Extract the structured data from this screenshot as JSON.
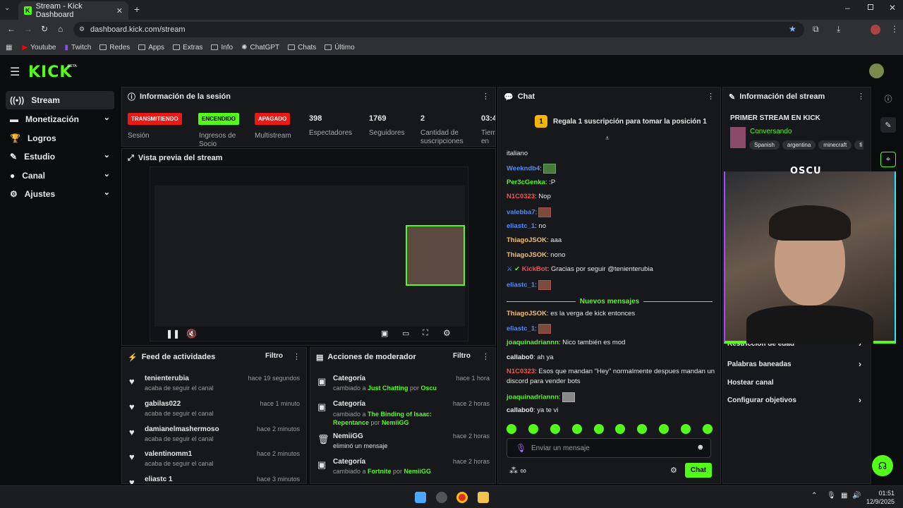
{
  "browser": {
    "tab_title": "Stream - Kick Dashboard",
    "url": "dashboard.kick.com/stream",
    "bookmarks": [
      "Youtube",
      "Twitch",
      "Redes",
      "Apps",
      "Extras",
      "Info",
      "ChatGPT",
      "Chats",
      "Último"
    ]
  },
  "sidebar": {
    "items": [
      {
        "label": "Stream",
        "icon": "broadcast-icon"
      },
      {
        "label": "Monetización",
        "icon": "money-icon"
      },
      {
        "label": "Logros",
        "icon": "trophy-icon"
      },
      {
        "label": "Estudio",
        "icon": "brush-icon"
      },
      {
        "label": "Canal",
        "icon": "user-icon"
      },
      {
        "label": "Ajustes",
        "icon": "gear-icon"
      }
    ]
  },
  "session": {
    "title": "Información de la sesión",
    "badges": [
      {
        "text": "TRANSMITIENDO",
        "label": "Sesión",
        "color": "#e91916"
      },
      {
        "text": "ENCENDIDO",
        "label": "Ingresos de Socio",
        "color": "#53fc18"
      },
      {
        "text": "APAGADO",
        "label": "Multistream",
        "color": "#e91916"
      }
    ],
    "stats": [
      {
        "value": "398",
        "label": "Espectadores"
      },
      {
        "value": "1769",
        "label": "Seguidores"
      },
      {
        "value": "2",
        "label": "Cantidad de suscripciones"
      },
      {
        "value": "03:4",
        "label": "Tiem en vi"
      }
    ]
  },
  "preview": {
    "title": "Vista previa del stream"
  },
  "activity": {
    "title": "Feed de actividades",
    "filter": "Filtro",
    "items": [
      {
        "name": "tenienterubia",
        "sub": "acaba de seguir el canal",
        "time": "hace 19 segundos"
      },
      {
        "name": "gabilas022",
        "sub": "acaba de seguir el canal",
        "time": "hace 1 minuto"
      },
      {
        "name": "damianelmashermoso",
        "sub": "acaba de seguir el canal",
        "time": "hace 2 minutos"
      },
      {
        "name": "valentinomm1",
        "sub": "acaba de seguir el canal",
        "time": "hace 2 minutos"
      },
      {
        "name": "eliastc 1",
        "sub": "",
        "time": "hace 3 minutos"
      }
    ]
  },
  "mod": {
    "title": "Acciones de moderador",
    "filter": "Filtro",
    "items": [
      {
        "name": "Categoría",
        "pre": "cambiado a ",
        "target": "Just Chatting",
        "mid": " por ",
        "by": "Oscu",
        "time": "hace 1 hora"
      },
      {
        "name": "Categoría",
        "pre": "cambiado a ",
        "target": "The Binding of Isaac: Repentance",
        "mid": " por ",
        "by": "NemiiGG",
        "time": "hace 2 horas"
      },
      {
        "name": "NemiiGG",
        "pre": "eliminó un mensaje",
        "target": "",
        "mid": "",
        "by": "",
        "time": "hace 2 horas"
      },
      {
        "name": "Categoría",
        "pre": "cambiado a ",
        "target": "Fortnite",
        "mid": " por ",
        "by": "NemiiGG",
        "time": "hace 2 horas"
      }
    ]
  },
  "chat": {
    "title": "Chat",
    "pinned": "Regala 1 suscripción para tomar la posición 1",
    "pinned_num": "1",
    "new_messages": "Nuevos mensajes",
    "input_placeholder": "Enviar un mensaje",
    "send": "Chat",
    "messages_top": [
      {
        "user": "",
        "color": "#ccc",
        "text": "italiano"
      },
      {
        "user": "Weekndb4",
        "color": "#4f8cff",
        "text": ":",
        "emote": true
      },
      {
        "user": "Per3cGenka",
        "color": "#53fc18",
        "text": ": :P"
      },
      {
        "user": "N1C0323",
        "color": "#ff4d4d",
        "text": ": Nop"
      },
      {
        "user": "valebba7",
        "color": "#4f8cff",
        "text": ":",
        "emote": true
      },
      {
        "user": "eliastc_1",
        "color": "#4f8cff",
        "text": ": no"
      },
      {
        "user": "ThiagoJSOK",
        "color": "#f4c06b",
        "text": ": aaa"
      },
      {
        "user": "ThiagoJSOK",
        "color": "#f4c06b",
        "text": ": nono"
      },
      {
        "user": "KickBot",
        "color": "#ff4d4d",
        "text": ": Gracias por seguir @tenienterubia"
      },
      {
        "user": "eliastc_1",
        "color": "#4f8cff",
        "text": ":",
        "emote": true
      }
    ],
    "messages_new": [
      {
        "user": "ThiagoJSOK",
        "color": "#f4c06b",
        "text": ": es la verga de kick entonces"
      },
      {
        "user": "eliastc_1",
        "color": "#4f8cff",
        "text": ":",
        "emote": true
      },
      {
        "user": "joaquinadriannn",
        "color": "#53fc18",
        "text": ": Nico también es mod"
      },
      {
        "user": "callabo0",
        "color": "#e8e8e8",
        "text": ": ah ya"
      },
      {
        "user": "N1C0323",
        "color": "#ff4d4d",
        "text": ": Esos que mandan \"Hey\" normalmente despues mandan un"
      },
      {
        "user": "",
        "color": "#e8e8e8",
        "text": "discord para vender bots"
      },
      {
        "user": "joaquinadriannn",
        "color": "#53fc18",
        "text": ":",
        "emote": true
      },
      {
        "user": "callabo0",
        "color": "#e8e8e8",
        "text": ": ya te vi"
      }
    ]
  },
  "stream_info": {
    "title": "Información del stream",
    "stream_title": "PRIMER STREAM EN KICK",
    "category": "Conversando",
    "tags": [
      "Spanish",
      "argentina",
      "minecraft",
      "fi"
    ],
    "cam_label": "OSCU",
    "menu": [
      {
        "label": "Restricción de edad"
      },
      {
        "label": "Palabras baneadas"
      },
      {
        "label": "Hostear canal"
      },
      {
        "label": "Configurar objetivos"
      }
    ]
  },
  "taskbar": {
    "time": "01:51",
    "date": "12/9/2025"
  }
}
